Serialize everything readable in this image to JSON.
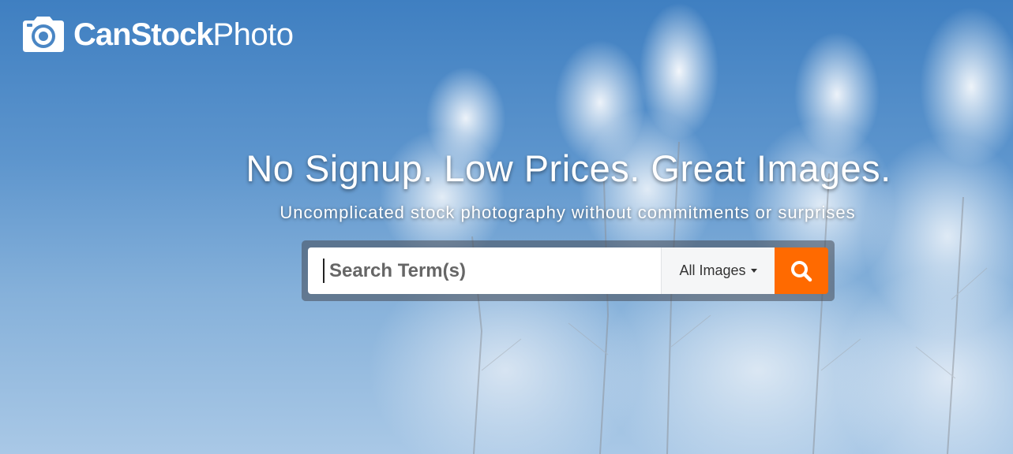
{
  "brand": {
    "name_bold": "CanStock",
    "name_light": "Photo",
    "logo_icon": "camera-icon"
  },
  "hero": {
    "headline": "No Signup. Low Prices. Great Images.",
    "subheadline": "Uncomplicated stock photography without commitments or surprises"
  },
  "search": {
    "placeholder": "Search Term(s)",
    "value": "",
    "type_selected": "All Images",
    "submit_icon": "search-icon",
    "accent_color": "#ff6a00"
  }
}
